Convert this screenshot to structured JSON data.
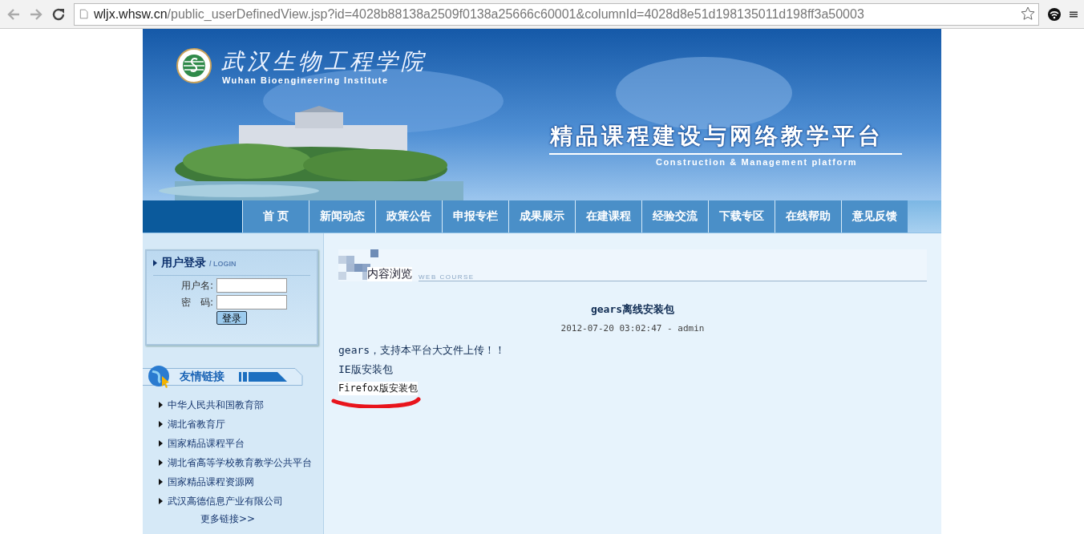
{
  "browser": {
    "url_host": "wljx.whsw.cn",
    "url_path": "/public_userDefinedView.jsp?id=4028b88138a2509f0138a25666c60001&columnId=4028d8e51d198135011d198ff3a50003"
  },
  "banner": {
    "school_name": "武汉生物工程学院",
    "school_name_en": "Wuhan Bioengineering Institute",
    "title": "精品课程建设与网络教学平台",
    "subtitle": "Construction & Management platform"
  },
  "nav": [
    "首 页",
    "新闻动态",
    "政策公告",
    "申报专栏",
    "成果展示",
    "在建课程",
    "经验交流",
    "下载专区",
    "在线帮助",
    "意见反馈"
  ],
  "login": {
    "title": "用户登录",
    "title_en": "/ LOGIN",
    "username_label": "用户名:",
    "password_label": "密　码:",
    "button": "登录"
  },
  "links": {
    "title": "友情链接",
    "items": [
      "中华人民共和国教育部",
      "湖北省教育厅",
      "国家精品课程平台",
      "湖北省高等学校教育教学公共平台",
      "国家精品课程资源网",
      "武汉高德信息产业有限公司"
    ],
    "more": "更多链接>>"
  },
  "content": {
    "section_title": "内容浏览",
    "section_title_en": "WEB COURSE",
    "article_title": "gears离线安装包",
    "meta": "2012-07-20 03:02:47 - admin",
    "lines": [
      {
        "text": "gears，支持本平台大文件上传！！",
        "highlighted": false
      },
      {
        "text": "IE版安装包",
        "highlighted": false
      },
      {
        "text": "Firefox版安装包",
        "highlighted": true
      }
    ]
  }
}
